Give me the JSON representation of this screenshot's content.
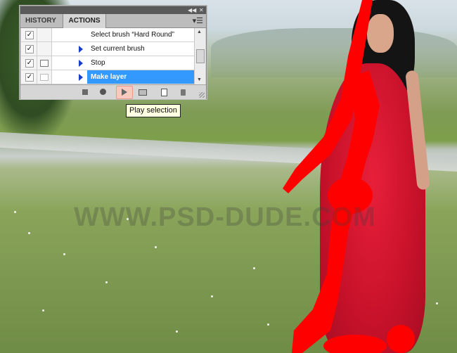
{
  "panel": {
    "tabs": [
      {
        "label": "HISTORY",
        "active": false
      },
      {
        "label": "ACTIONS",
        "active": true
      }
    ],
    "actions": [
      {
        "label": "Select brush “Hard Round”",
        "checked": true,
        "dialog": false,
        "selected": false
      },
      {
        "label": "Set current brush",
        "checked": true,
        "dialog": false,
        "selected": false
      },
      {
        "label": "Stop",
        "checked": true,
        "dialog": true,
        "selected": false
      },
      {
        "label": "Make layer",
        "checked": true,
        "dialog": false,
        "selected": true
      }
    ],
    "footer_icons": [
      "stop-icon",
      "record-icon",
      "play-icon",
      "create-set-icon",
      "new-action-icon",
      "delete-icon"
    ]
  },
  "tooltip": {
    "text": "Play selection"
  },
  "watermark": {
    "text": "WWW.PSD-DUDE.COM"
  },
  "colors": {
    "selection": "#3399ff",
    "mask_red": "#ff0000",
    "panel_bg": "#d6d6d6"
  }
}
